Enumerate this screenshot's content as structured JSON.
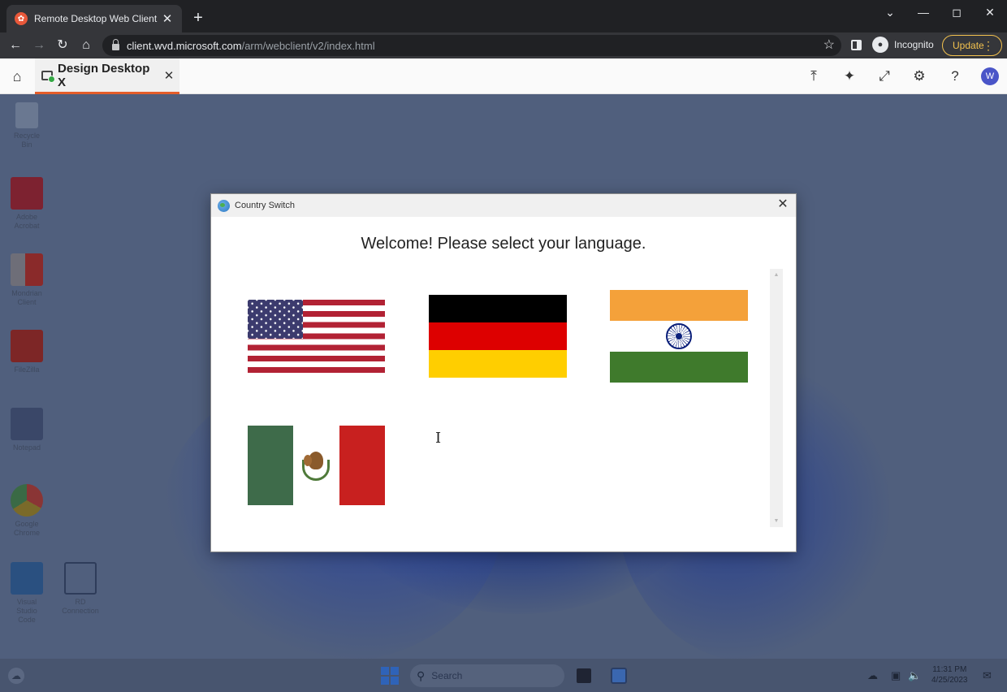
{
  "browser": {
    "tab_title": "Remote Desktop Web Client",
    "tab_favicon": "rd-favicon",
    "url_host": "client.wvd.microsoft.com",
    "url_path": "/arm/webclient/v2/index.html",
    "profile_label": "Incognito",
    "update_label": "Update"
  },
  "rdclient": {
    "session_tab": "Design Desktop X",
    "avatar_initial": "W",
    "accent": "#e45d2a"
  },
  "desktop": {
    "icons": [
      {
        "label": "Recycle Bin"
      },
      {
        "label": "Adobe Acrobat"
      },
      {
        "label": "Mondrian Client"
      },
      {
        "label": "FileZilla"
      },
      {
        "label": "Notepad"
      },
      {
        "label": "Google Chrome"
      },
      {
        "label": "Visual Studio Code"
      },
      {
        "label": "RD Connection"
      }
    ]
  },
  "dialog": {
    "title": "Country Switch",
    "heading": "Welcome!  Please select your language.",
    "flags": [
      {
        "country": "United States",
        "colors": [
          "#b22234",
          "#ffffff",
          "#3c3b6e"
        ]
      },
      {
        "country": "Germany",
        "colors": [
          "#000000",
          "#dd0000",
          "#ffce00"
        ]
      },
      {
        "country": "India",
        "colors": [
          "#f4a13a",
          "#ffffff",
          "#3f7a2c"
        ]
      },
      {
        "country": "Mexico",
        "colors": [
          "#3e6b4a",
          "#ffffff",
          "#c8201f"
        ]
      }
    ]
  },
  "taskbar": {
    "search_placeholder": "Search",
    "time": "11:31 PM",
    "date": "4/25/2023"
  }
}
